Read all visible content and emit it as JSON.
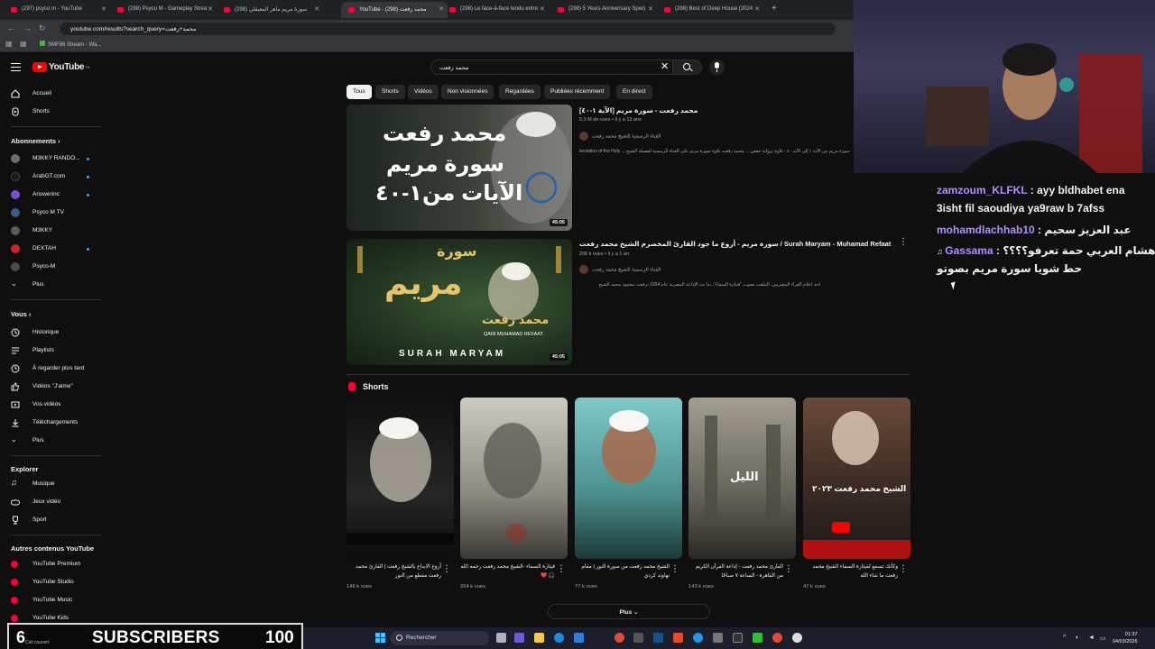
{
  "browser": {
    "tabs": [
      {
        "label": "(297) psyco m - YouTube"
      },
      {
        "label": "(298) Psyco M - Gameplay Strea"
      },
      {
        "label": "(298) سورة مريم ماهر المعيقلي"
      },
      {
        "label": "YouTube - محمد رفعت (298)"
      },
      {
        "label": "(298) Le face-à-face tendu entre"
      },
      {
        "label": "(298) 5 Years Anniversary Speci"
      },
      {
        "label": "(298) Best of Deep House [2024"
      }
    ],
    "url": "youtube.com/results?search_query=محمد+رفعت",
    "bookmark": "SMF86 Stream - Wa..."
  },
  "youtube": {
    "logo": "YouTube",
    "logo_region": "TN",
    "search_value": "محمد رفعت"
  },
  "sidebar": {
    "top": [
      {
        "label": "Accueil",
        "icon": "home-icon"
      },
      {
        "label": "Shorts",
        "icon": "shorts-icon"
      }
    ],
    "subs_heading": "Abonnements",
    "subs": [
      {
        "label": "M3KKY RANDO...",
        "dot": true,
        "color": "#6b6b6b"
      },
      {
        "label": "ArabGT.com",
        "dot": true,
        "color": "#1a1a1a"
      },
      {
        "label": "Answerinc",
        "dot": true,
        "color": "#7a4bd6"
      },
      {
        "label": "Psyco M TV",
        "dot": false,
        "color": "#3a5a8a"
      },
      {
        "label": "M3KKY",
        "dot": false,
        "color": "#5a5a5a"
      },
      {
        "label": "DEXTAH",
        "dot": true,
        "color": "#d62020"
      },
      {
        "label": "Psyco-M",
        "dot": false,
        "color": "#4a4a4a"
      }
    ],
    "subs_more": "Plus",
    "you_heading": "Vous",
    "you": [
      {
        "label": "Historique",
        "icon": "history-icon"
      },
      {
        "label": "Playlists",
        "icon": "playlists-icon"
      },
      {
        "label": "À regarder plus tard",
        "icon": "watch-later-icon"
      },
      {
        "label": "Vidéos \"J'aime\"",
        "icon": "like-icon"
      },
      {
        "label": "Vos vidéos",
        "icon": "your-videos-icon"
      },
      {
        "label": "Téléchargements",
        "icon": "download-icon"
      },
      {
        "label": "Plus",
        "icon": "chevron-down-icon"
      }
    ],
    "explore_heading": "Explorer",
    "explore": [
      {
        "label": "Musique",
        "icon": "music-icon"
      },
      {
        "label": "Jeux vidéo",
        "icon": "gaming-icon"
      },
      {
        "label": "Sport",
        "icon": "trophy-icon"
      }
    ],
    "more_heading": "Autres contenus YouTube",
    "more": [
      {
        "label": "YouTube Premium"
      },
      {
        "label": "YouTube Studio"
      },
      {
        "label": "YouTube Music"
      },
      {
        "label": "YouTube Kids"
      }
    ]
  },
  "chips": [
    "Tous",
    "Shorts",
    "Vidéos",
    "Non visionnées",
    "Regardées",
    "Publiées récemment",
    "En direct"
  ],
  "videos": [
    {
      "title": "محمد رفعت - سورة مريم [الآية ١-٤٠]",
      "meta": "5,3 M de vues • il y a 13 ans",
      "channel": "القناة الرسمية للشيخ محمد رفعت",
      "desc": "سورة مريم من الآية ١ إلى الآية ٤٠ - تلاوة برواية حفص ... محمد رفعت تلاوة سورة مريم على القناة الرسمية لفضيلة الشيخ ... Recitation of the Holy",
      "duration": "45:05",
      "thumb_lines": [
        "محمد رفعت",
        "سورة مريم",
        "الآيات من١-٤٠"
      ]
    },
    {
      "title": "سورة مريم - أروع ما جود القارئ المخضرم الشيخ محمد رفعت / Surah Maryam - Muhamad Refaat",
      "meta": "206 k vues • il y a 1 an",
      "channel": "القناة الرسمية للشيخ محمد رفعت",
      "desc": "أحد أعلام القراء المصريين، الملقب بصوت \"قيثارة السماء\"، بدأ بث الإذاعة المصرية عام 1934 برفعت محمود محمد الشيخ",
      "duration": "45:05",
      "thumb_lines": [
        "سورة",
        "مريم",
        "محمد رفعت",
        "QARI MUHAMAD REFAAT",
        "SURAH MARYAM"
      ]
    }
  ],
  "shorts": {
    "heading": "Shorts",
    "items": [
      {
        "title": "أروع الابداع بالشيخ رفعت | القارئ محمد رفعت مقطع من النور",
        "views": "146 k vues",
        "overlay": ""
      },
      {
        "title": "قيثارة السماء -الشيخ محمد رفعت رحمه الله 🎧 ❤️",
        "views": "264 k vues",
        "overlay": ""
      },
      {
        "title": "الشيخ محمد رفعت من سورة النور | مقام نهاوند كردي",
        "views": "77 k vues",
        "overlay": ""
      },
      {
        "title": "القارئ محمد رفعت - إذاعة القرآن الكريم من القاهرة - الساعة ٧ صباحًا",
        "views": "143 k vues",
        "overlay": "الليل"
      },
      {
        "title": "وكأنك تسمع لقيثارة السماء الشيخ محمد رفعت ما شاء الله",
        "views": "47 k vues",
        "overlay": "الشيخ محمد رفعت ٢٠٢٣"
      }
    ],
    "more_label": "Plus"
  },
  "chat": [
    {
      "user": "zamzoum_KLFKL",
      "sep": " : ",
      "text": "ayy bldhabet ena",
      "cont": "3isht fil saoudiya ya9raw b 7afss"
    },
    {
      "user": "mohamdlachhab10",
      "sep": " : ",
      "text": "عبد العزيز سحيم",
      "cont": ""
    },
    {
      "user": "Gassama",
      "sep": " : ",
      "text": "عمر هشام العربي حمة تعرفو؟؟؟؟",
      "cont": "حط شويا سورة مريم بصوتو"
    }
  ],
  "subscribers": {
    "count": "6",
    "label": "SUBSCRIBERS",
    "goal": "100",
    "weather": "Ciel couvert"
  },
  "taskbar": {
    "search": "Rechercher",
    "time": "01:37",
    "date": "04/03/2026"
  }
}
